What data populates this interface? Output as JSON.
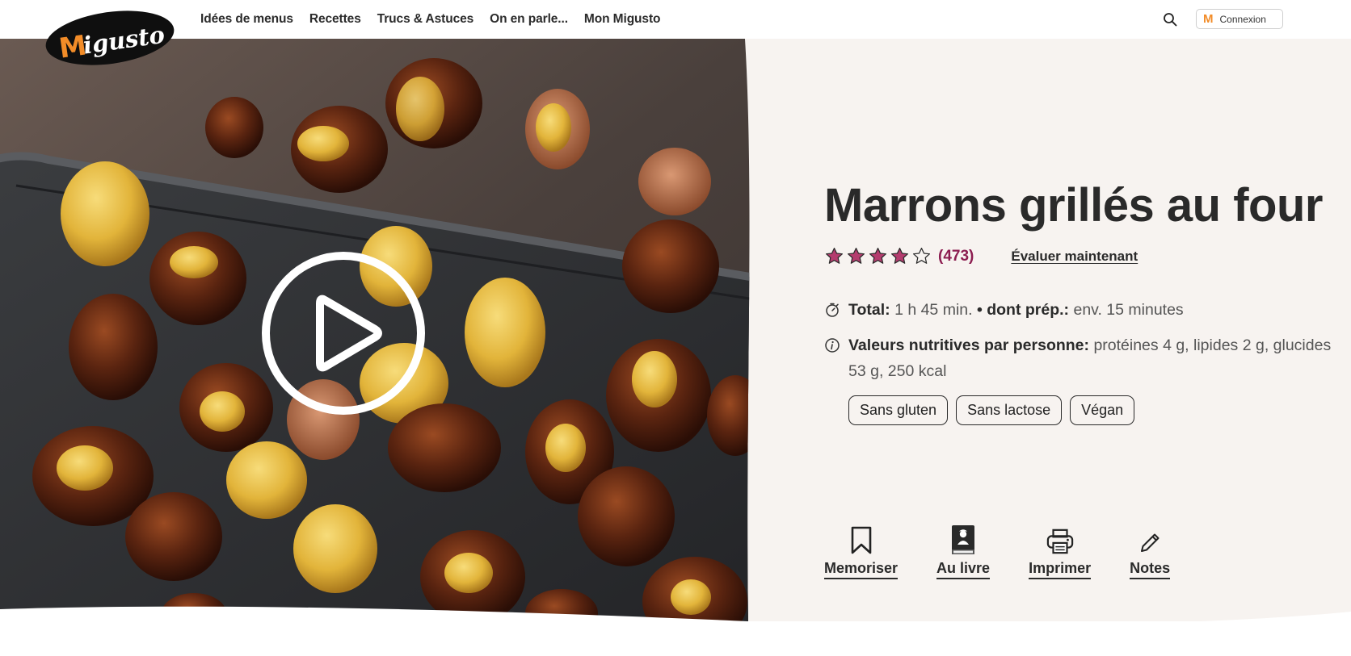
{
  "header": {
    "logo_text": "Migusto",
    "nav": [
      "Idées de menus",
      "Recettes",
      "Trucs & Astuces",
      "On en parle...",
      "Mon Migusto"
    ],
    "login_mark": "M",
    "login_label": "Connexion"
  },
  "recipe": {
    "title": "Marrons grillés au four",
    "rating": {
      "value": 4,
      "max": 5,
      "count": "(473)"
    },
    "rate_link": "Évaluer maintenant",
    "time": {
      "total_label": "Total:",
      "total_value": "1 h 45 min.",
      "separator": "•",
      "prep_label": "dont prép.:",
      "prep_value": "env. 15 minutes"
    },
    "nutrition": {
      "label": "Valeurs nutritives par personne:",
      "value": "protéines 4 g, lipides 2 g, glucides 53 g, 250 kcal"
    },
    "tags": [
      "Sans gluten",
      "Sans lactose",
      "Végan"
    ],
    "actions": [
      {
        "label": "Memoriser",
        "icon": "bookmark-icon"
      },
      {
        "label": "Au livre",
        "icon": "book-icon"
      },
      {
        "label": "Imprimer",
        "icon": "printer-icon"
      },
      {
        "label": "Notes",
        "icon": "pencil-icon"
      }
    ]
  },
  "colors": {
    "brand_orange": "#f28c28",
    "rating_purple": "#8c1d50",
    "star_fill": "#b43c6e",
    "panel_bg": "#f7f3f0"
  }
}
